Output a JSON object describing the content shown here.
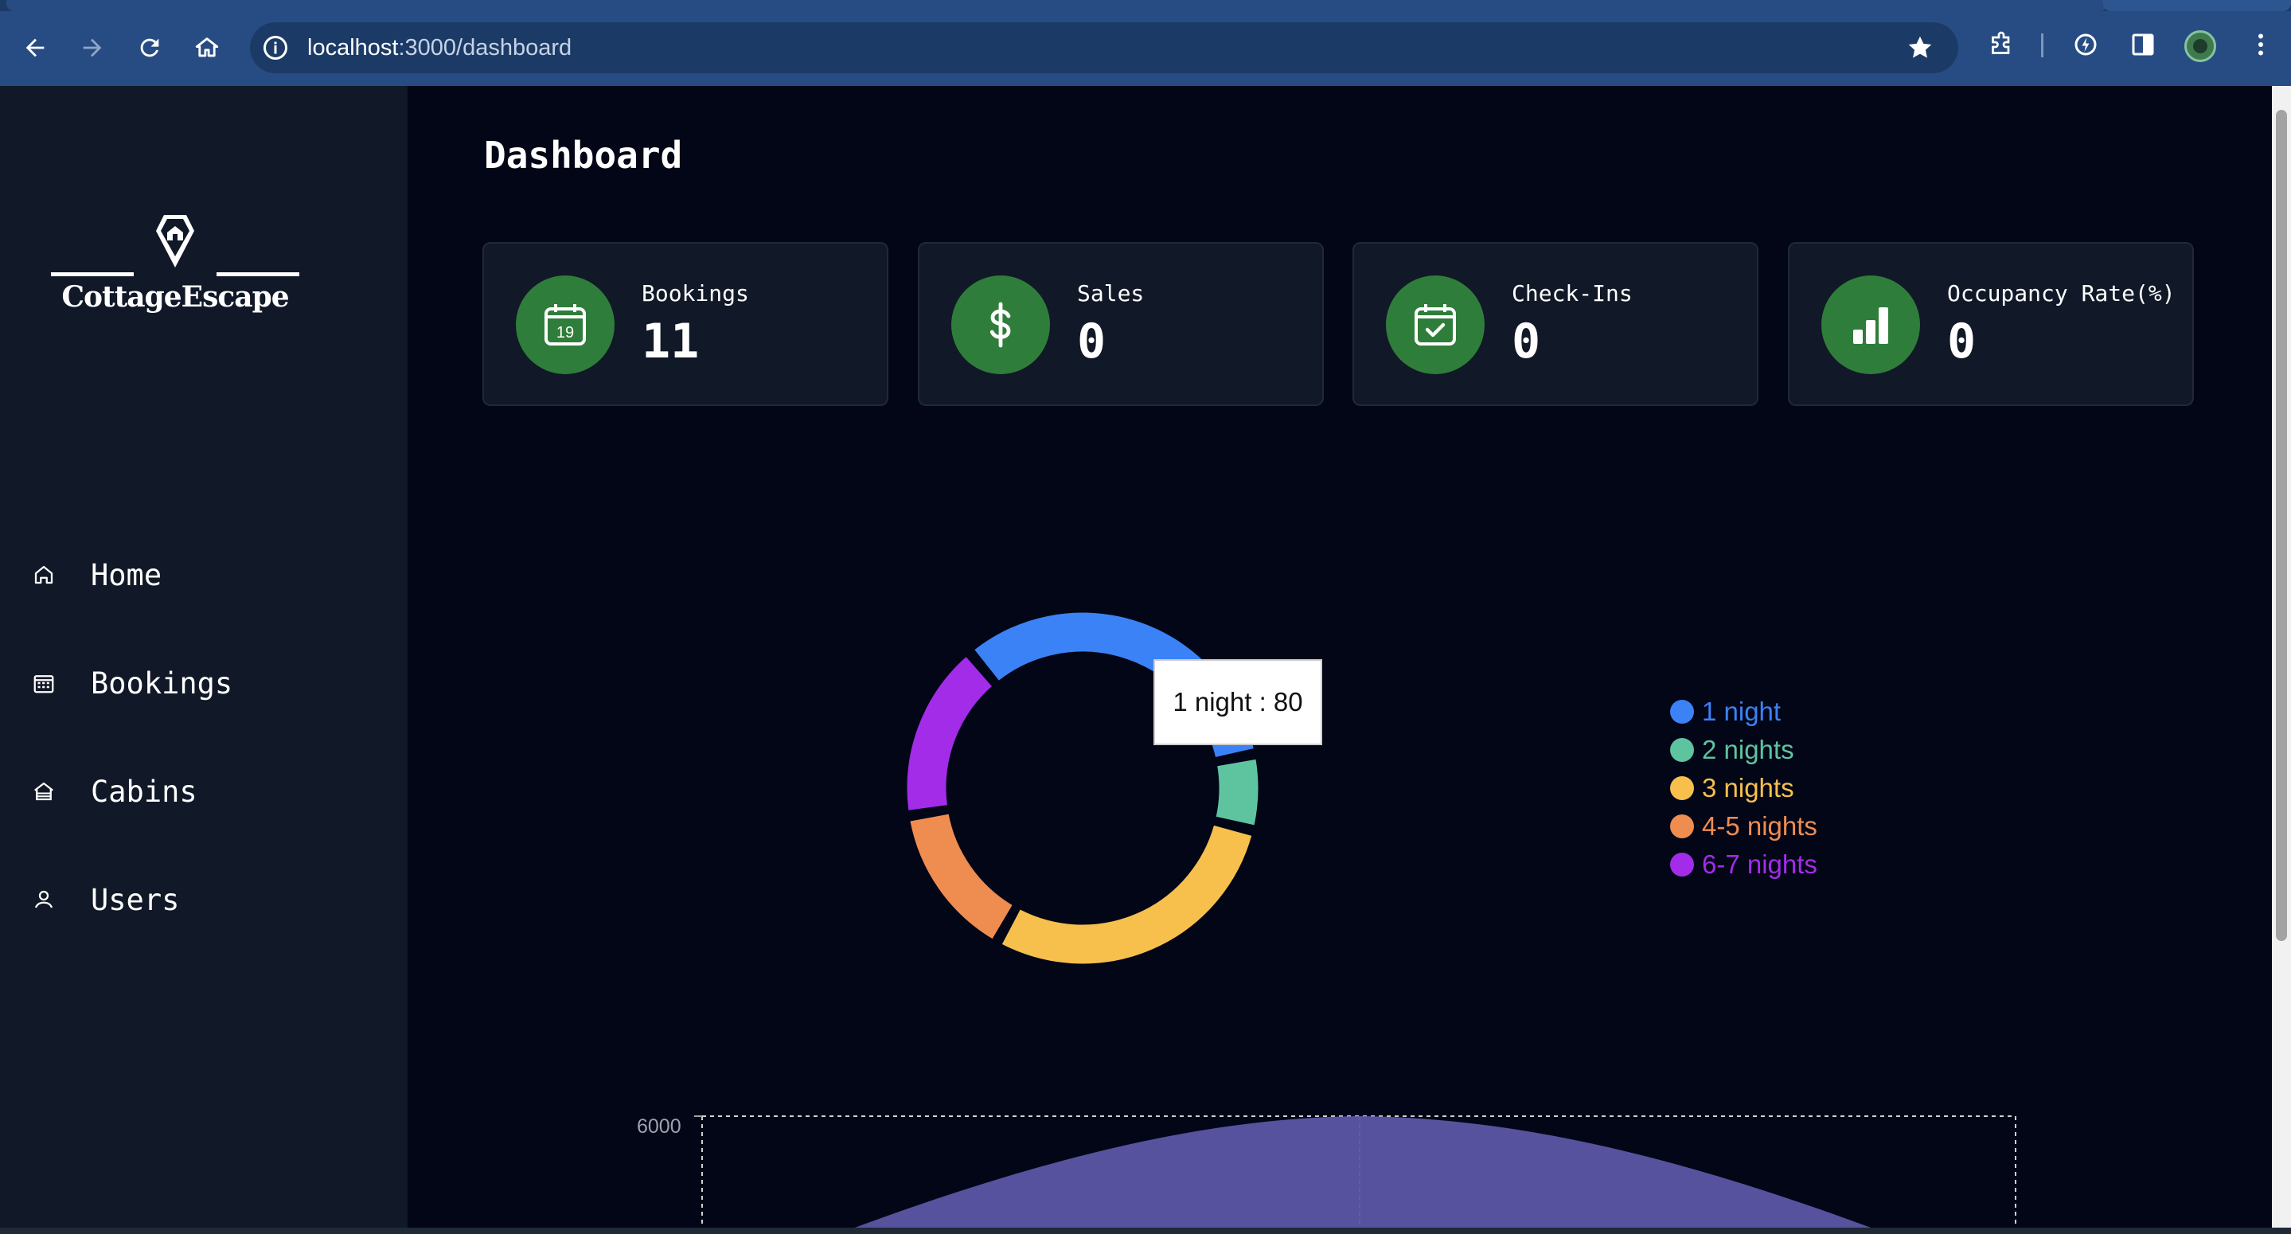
{
  "browser": {
    "url_host": "localhost",
    "url_path": ":3000/dashboard"
  },
  "app": {
    "brand": "CottageEscape",
    "nav": [
      {
        "label": "Home",
        "icon": "home-icon"
      },
      {
        "label": "Bookings",
        "icon": "calendar-icon"
      },
      {
        "label": "Cabins",
        "icon": "cabin-icon"
      },
      {
        "label": "Users",
        "icon": "user-icon"
      }
    ]
  },
  "dashboard": {
    "title": "Dashboard",
    "stats": [
      {
        "label": "Bookings",
        "value": "11",
        "icon": "calendar-19-icon"
      },
      {
        "label": "Sales",
        "value": "0",
        "icon": "dollar-icon"
      },
      {
        "label": "Check-Ins",
        "value": "0",
        "icon": "calendar-check-icon"
      },
      {
        "label": "Occupancy Rate(%)",
        "value": "0",
        "icon": "bar-chart-icon"
      }
    ],
    "tooltip": "1 night : 80"
  },
  "chart_data": [
    {
      "type": "pie",
      "title": "",
      "categories": [
        "1 night",
        "2 nights",
        "3 nights",
        "4-5 nights",
        "6-7 nights"
      ],
      "values": [
        80,
        17,
        71,
        35,
        40
      ],
      "colors": [
        "#3b82f6",
        "#5ec4a0",
        "#f7c04d",
        "#ef8c50",
        "#a22ce8"
      ],
      "legend": "right",
      "tooltip_category": "1 night"
    },
    {
      "type": "area",
      "title": "",
      "y_tick_labels": [
        "6000"
      ],
      "ylim": [
        0,
        6000
      ],
      "series_color": "#5b56a4",
      "grid": true
    }
  ]
}
